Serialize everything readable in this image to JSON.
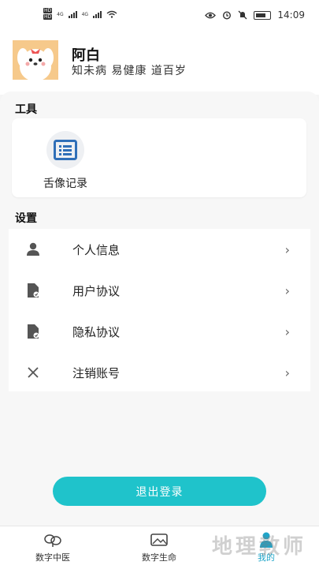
{
  "status": {
    "time": "14:09",
    "hd1": "HD",
    "hd2": "HD",
    "net1": "4G",
    "net2": "4G"
  },
  "profile": {
    "name": "阿白",
    "motto": "知未病 易健康 道百岁"
  },
  "tools": {
    "title": "工具",
    "items": [
      {
        "label": "舌像记录",
        "icon": "list-icon"
      }
    ]
  },
  "settings": {
    "title": "设置",
    "items": [
      {
        "label": "个人信息",
        "icon": "person-icon"
      },
      {
        "label": "用户协议",
        "icon": "document-icon"
      },
      {
        "label": "隐私协议",
        "icon": "document-icon"
      },
      {
        "label": "注销账号",
        "icon": "close-icon"
      }
    ]
  },
  "logout_label": "退出登录",
  "tabs": [
    {
      "label": "数字中医",
      "icon": "herb-icon"
    },
    {
      "label": "数字生命",
      "icon": "image-icon"
    },
    {
      "label": "我的",
      "icon": "profile-icon",
      "active": true
    }
  ],
  "watermark": "地理教师",
  "colors": {
    "accent": "#1fc3cb",
    "tool_icon": "#2f6fb8"
  }
}
